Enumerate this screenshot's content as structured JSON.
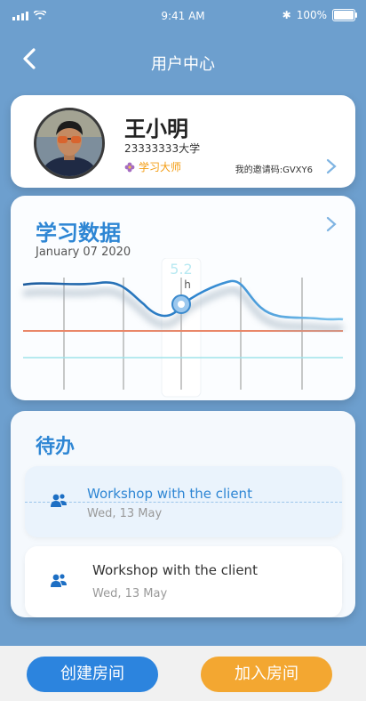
{
  "status_bar": {
    "time": "9:41 AM",
    "battery": "100%"
  },
  "header": {
    "title": "用户中心"
  },
  "profile": {
    "name": "王小明",
    "school": "23333333大学",
    "badge": "学习大师",
    "invite_code": "我的邀请码:GVXY6"
  },
  "study": {
    "title": "学习数据",
    "date": "January 07 2020",
    "highlight_value": "5.2",
    "highlight_unit": "h"
  },
  "todo": {
    "title": "待办",
    "items": [
      {
        "title": "Workshop with the client",
        "date": "Wed, 13 May"
      },
      {
        "title": "Workshop with the client",
        "date": "Wed, 13 May"
      }
    ]
  },
  "actions": {
    "create_room": "创建房间",
    "join_room": "加入房间"
  },
  "colors": {
    "accent": "#2e86d4",
    "join": "#f3a731",
    "background": "#6d9fce"
  }
}
